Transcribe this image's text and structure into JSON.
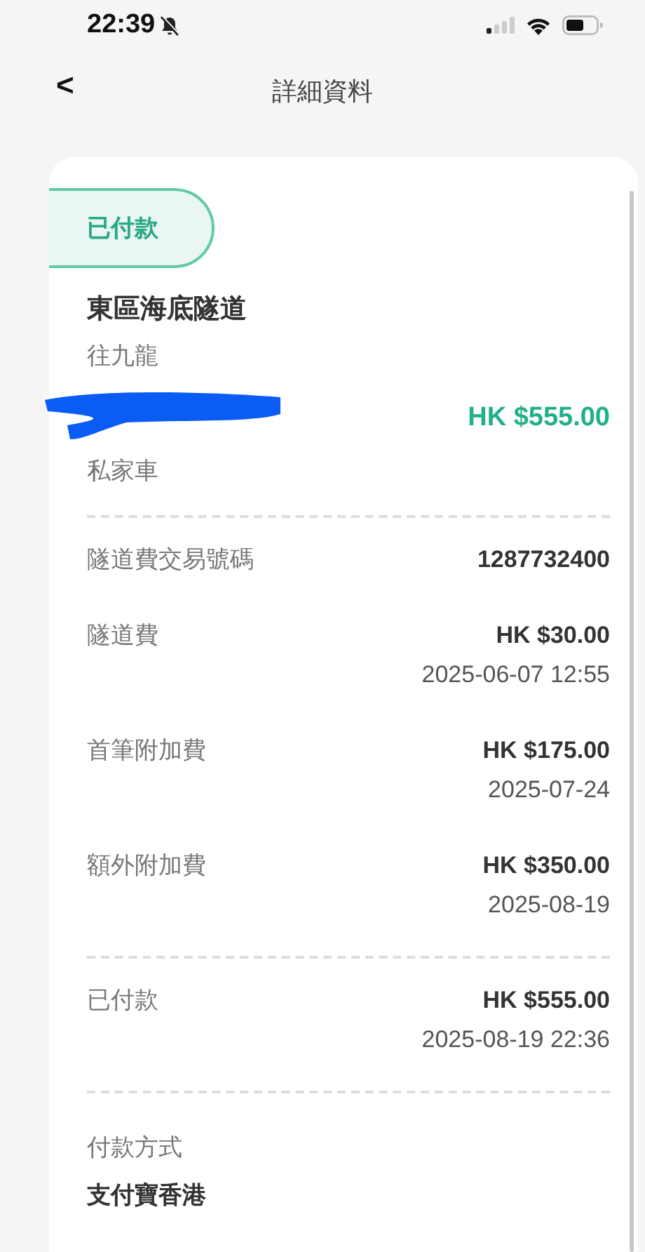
{
  "status_bar": {
    "time": "22:39"
  },
  "header": {
    "back": "<",
    "title": "詳細資料"
  },
  "card": {
    "status_badge": "已付款",
    "tunnel_name": "東區海底隧道",
    "direction": "往九龍",
    "total": "HK $555.00",
    "vehicle_type": "私家車",
    "sections": [
      {
        "rows": [
          {
            "label": "隧道費交易號碼",
            "value": "1287732400"
          },
          {
            "label": "隧道費",
            "value": "HK $30.00",
            "date": "2025-06-07 12:55"
          },
          {
            "label": "首筆附加費",
            "value": "HK $175.00",
            "date": "2025-07-24"
          },
          {
            "label": "額外附加費",
            "value": "HK $350.00",
            "date": "2025-08-19"
          }
        ]
      },
      {
        "rows": [
          {
            "label": "已付款",
            "value": "HK $555.00",
            "date": "2025-08-19 22:36"
          }
        ]
      }
    ],
    "payment_method": {
      "label": "付款方式",
      "value": "支付寶香港"
    }
  }
}
